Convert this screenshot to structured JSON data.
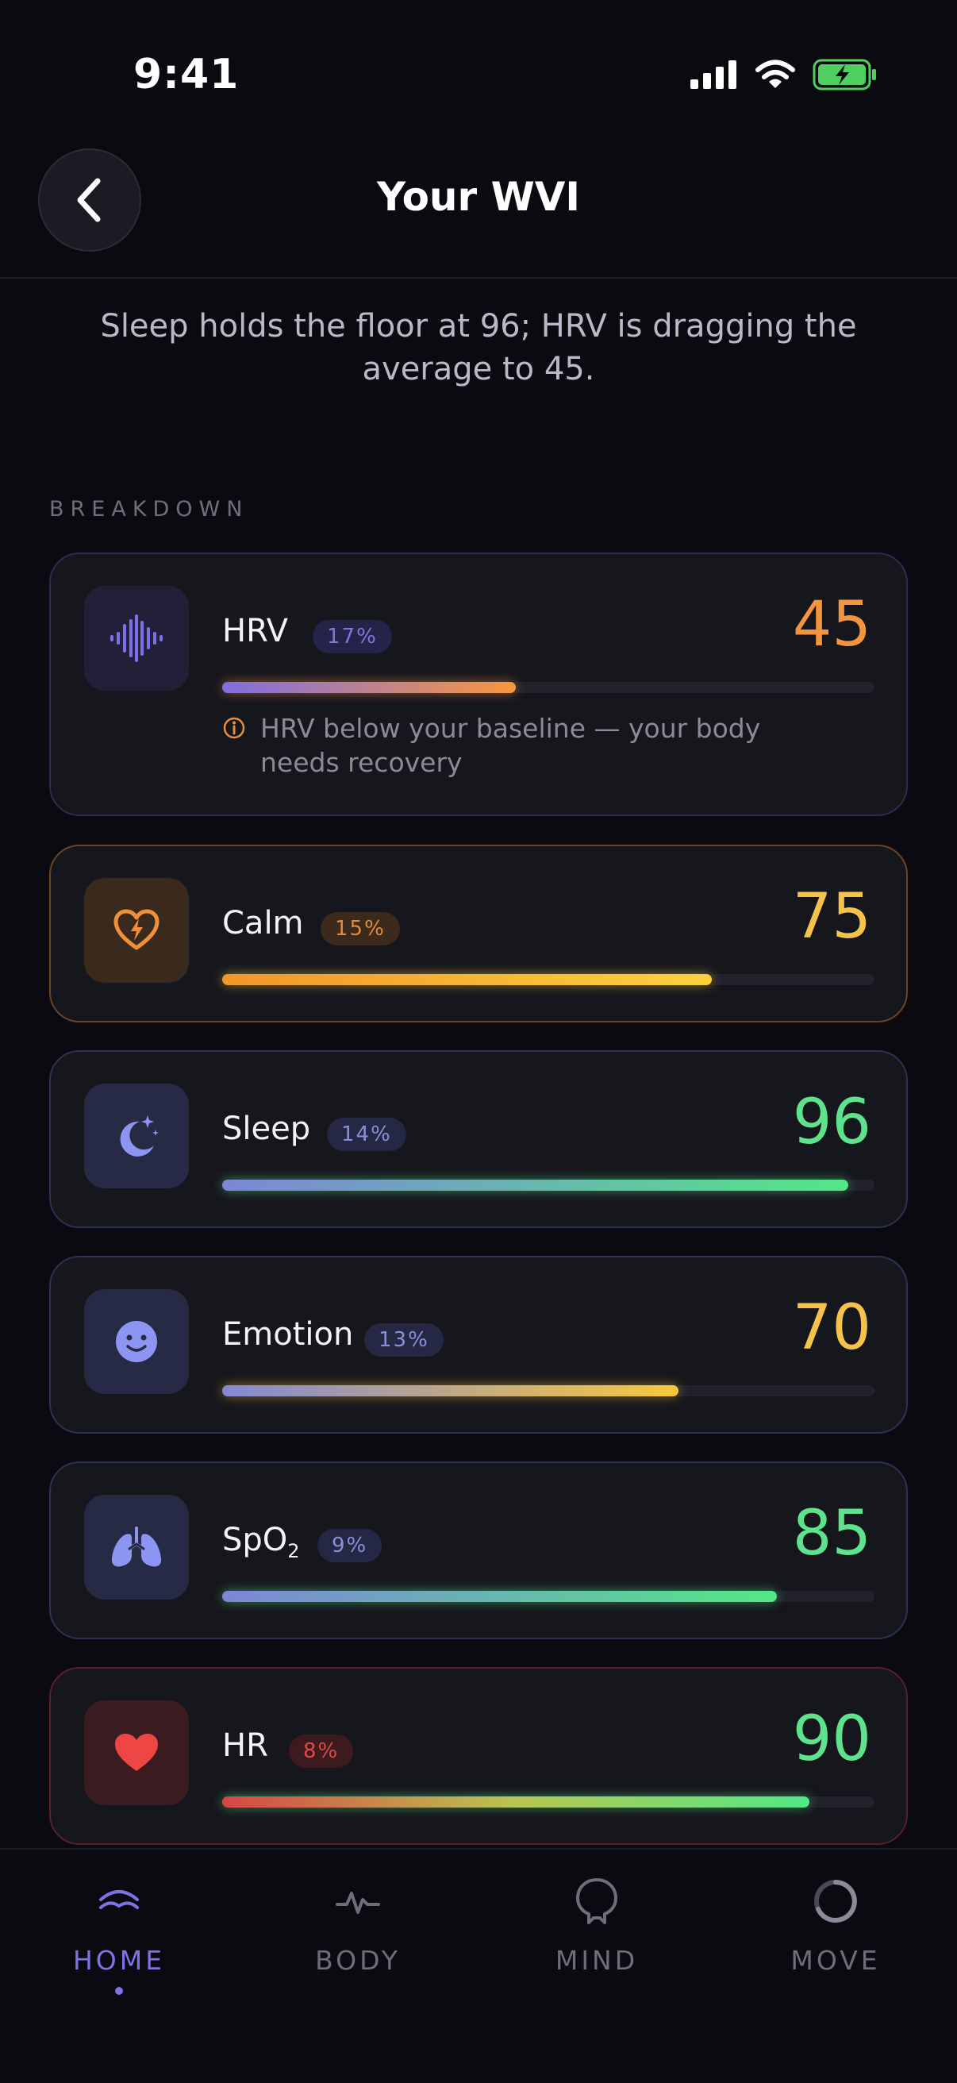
{
  "status": {
    "time": "9:41"
  },
  "header": {
    "title": "Your WVI"
  },
  "summary": "Sleep holds the floor at 96; HRV is dragging the average to 45.",
  "section_label": "BREAKDOWN",
  "metrics": [
    {
      "name": "HRV",
      "weight": "17%",
      "score": "45",
      "progress": 0.45,
      "score_color": "#f3953e",
      "bar_gradient": [
        "#7f6ee0",
        "#f99640"
      ],
      "border": "#2c2c52",
      "icon": "waveform-icon",
      "alert": "HRV below your baseline — your body needs recovery"
    },
    {
      "name": "Calm",
      "weight": "15%",
      "score": "75",
      "progress": 0.75,
      "score_color": "#f6c34a",
      "bar_gradient": [
        "#f0962c",
        "#fbd23e"
      ],
      "border": "#6b4526",
      "icon": "heart-bolt-icon"
    },
    {
      "name": "Sleep",
      "weight": "14%",
      "score": "96",
      "progress": 0.96,
      "score_color": "#5ee38c",
      "bar_gradient": [
        "#7d86d8",
        "#52e886"
      ],
      "border": "#2c3252",
      "icon": "moon-stars-icon"
    },
    {
      "name": "Emotion",
      "weight": "13%",
      "score": "70",
      "progress": 0.7,
      "score_color": "#f6c34a",
      "bar_gradient": [
        "#8388d4",
        "#f8c83c"
      ],
      "border": "#2c3252",
      "icon": "smile-face-icon"
    },
    {
      "name": "SpO",
      "name_sub": "2",
      "weight": "9%",
      "score": "85",
      "progress": 0.85,
      "score_color": "#5ee38c",
      "bar_gradient": [
        "#7d86d8",
        "#52e886"
      ],
      "border": "#2c3252",
      "icon": "lungs-icon"
    },
    {
      "name": "HR",
      "weight": "8%",
      "score": "90",
      "progress": 0.9,
      "score_color": "#5ee38c",
      "bar_gradient": [
        "#d74646",
        "#b8c653",
        "#52e886"
      ],
      "border": "#5a2026",
      "icon": "heart-icon"
    }
  ],
  "tabs": [
    {
      "label": "HOME",
      "icon": "home-waves-icon",
      "active": true
    },
    {
      "label": "BODY",
      "icon": "pulse-icon",
      "active": false
    },
    {
      "label": "MIND",
      "icon": "head-icon",
      "active": false
    },
    {
      "label": "MOVE",
      "icon": "ring-icon",
      "active": false
    }
  ],
  "colors": {
    "accent": "#7b73e6",
    "background": "#0a0a10",
    "card": "#16161d"
  }
}
